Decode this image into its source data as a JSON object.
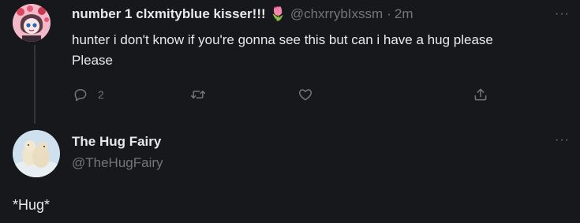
{
  "reply_tweet": {
    "display_name": "number 1 clxmityblue kisser!!!",
    "emoji": "🌷",
    "handle": "@chxrrybIxssm",
    "separator": "·",
    "time": "2m",
    "text_line1": "hunter i don't know if you're gonna see this but can i have a hug please",
    "text_line2": "Please",
    "more_label": "···",
    "actions": {
      "reply_count": "2"
    },
    "icons": [
      "reply-icon",
      "retweet-icon",
      "like-icon",
      "share-icon"
    ]
  },
  "main_tweet": {
    "display_name": "The Hug Fairy",
    "handle": "@TheHugFairy",
    "text": "*Hug*",
    "more_label": "···"
  },
  "colors": {
    "background": "#16181c",
    "text": "#e7e9ea",
    "muted": "#71767b",
    "thread_line": "#333639"
  }
}
